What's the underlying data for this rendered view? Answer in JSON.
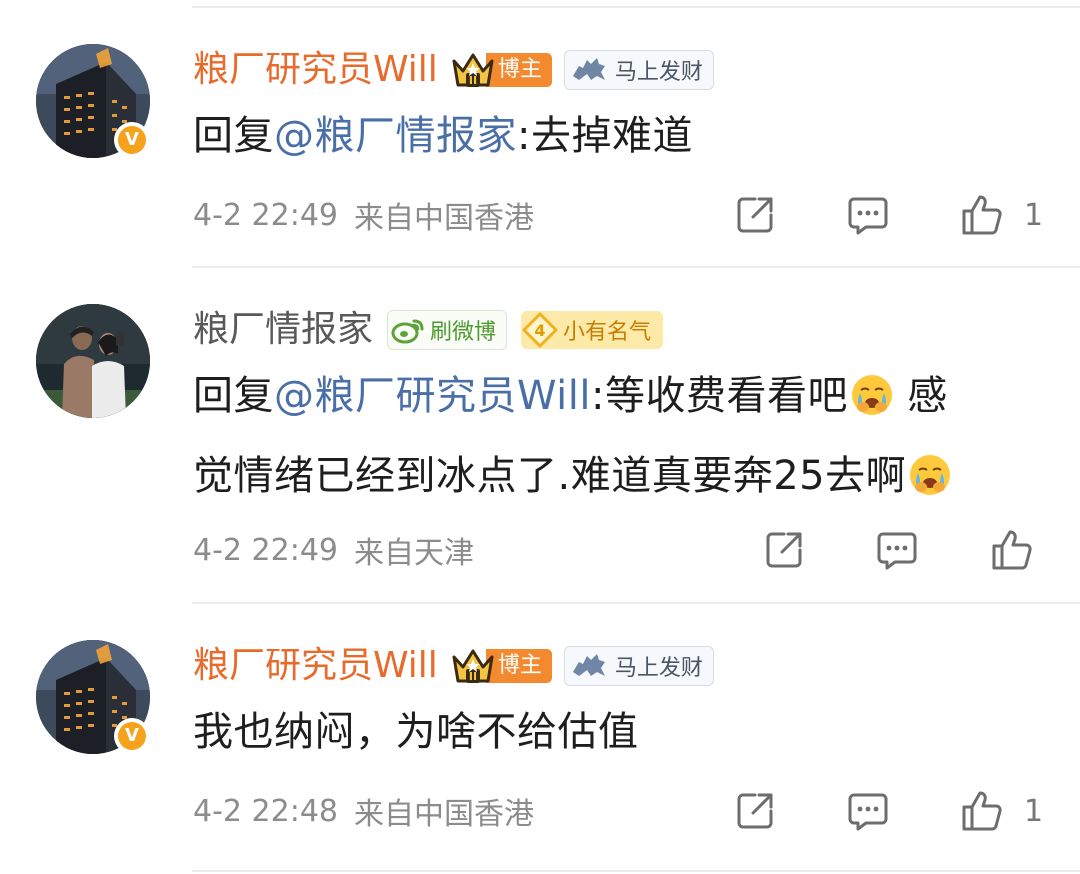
{
  "comments": [
    {
      "username": "粮厂研究员Will",
      "badges": {
        "role": "博主",
        "tag": "马上发财"
      },
      "reply_prefix": "回复",
      "mention": "@粮厂情报家",
      "text": ":去掉难道",
      "time": "4-2 22:49",
      "source": "来自中国香港",
      "likes": "1"
    },
    {
      "username": "粮厂情报家",
      "badges": {
        "weibo": "刷微博",
        "level_num": "4",
        "level": "小有名气"
      },
      "reply_prefix": "回复",
      "mention": "@粮厂研究员Will",
      "text_line1": ":等收费看看吧",
      "text_line1b": " 感",
      "text_line2": "觉情绪已经到冰点了.难道真要奔25去啊",
      "time": "4-2 22:49",
      "source": "来自天津",
      "likes": ""
    },
    {
      "username": "粮厂研究员Will",
      "badges": {
        "role": "博主",
        "tag": "马上发财"
      },
      "text": "我也纳闷，为啥不给估值",
      "time": "4-2 22:48",
      "source": "来自中国香港",
      "likes": "1"
    }
  ],
  "icons": {
    "share": "share-icon",
    "comment": "comment-icon",
    "like": "thumbs-up-icon",
    "emoji": "crying-emoji-icon",
    "crown": "crown-icon",
    "horse": "horse-icon",
    "weibo": "weibo-icon",
    "verified": "verified-v-icon"
  },
  "colors": {
    "vip_name": "#e86b2b",
    "normal_name": "#595959",
    "mention": "#4a6fa8",
    "meta": "#8c8c8c",
    "blogger_badge": "#f38a2f",
    "weibo_green": "#4e9a2f",
    "level_gold": "#c67e00"
  }
}
